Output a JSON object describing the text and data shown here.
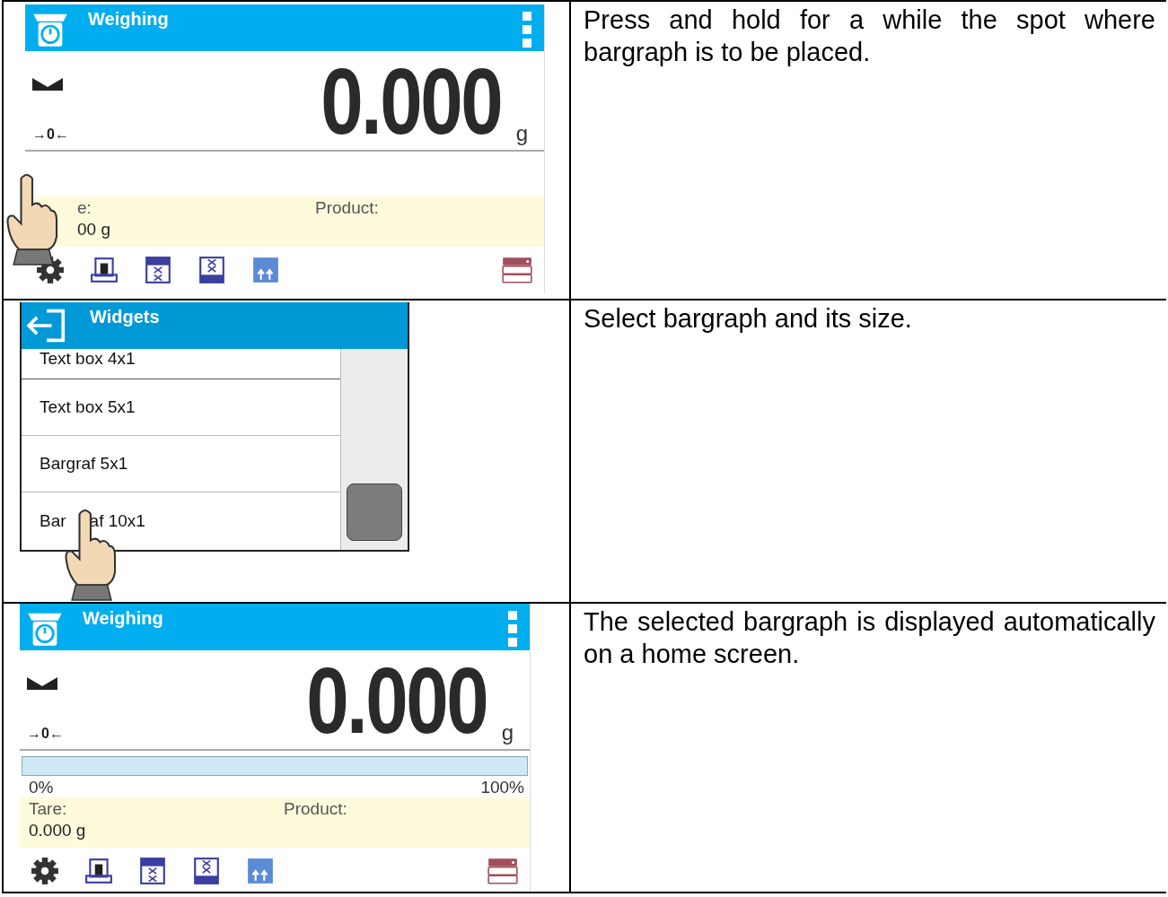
{
  "rows": [
    {
      "screen": {
        "kind": "weighing",
        "title": "Weighing",
        "zero_marker": "→0←",
        "reading": "0.000",
        "unit": "g",
        "pointer": true,
        "info": [
          {
            "label": "e:",
            "value": "00 g"
          },
          {
            "label": "Product:"
          }
        ]
      },
      "description": "Press and hold for a while the spot where bargraph is to be placed."
    },
    {
      "screen": {
        "kind": "menu",
        "title": "Widgets",
        "pointer": true,
        "items": [
          {
            "parts": [
              "Text box 4x1"
            ],
            "cut": true
          },
          {
            "parts": [
              "Text box 5x1"
            ],
            "cut": false
          },
          {
            "parts": [
              "Bargraf 5x1"
            ],
            "cut": false
          },
          {
            "parts": [
              "Bar",
              "af 10x1"
            ],
            "cut": false
          }
        ]
      },
      "description": "Select bargraph and its size."
    },
    {
      "screen": {
        "kind": "weighing",
        "title": "Weighing",
        "zero_marker": "→0←",
        "reading": "0.000",
        "unit": "g",
        "pointer": false,
        "bargraph": {
          "level": 0,
          "min_label": "0%",
          "max_label": "100%"
        },
        "info": [
          {
            "label": "Tare:",
            "value": "0.000 g"
          },
          {
            "label": "Product:"
          }
        ]
      },
      "description": "The selected bargraph is displayed automatically on a home screen."
    }
  ]
}
